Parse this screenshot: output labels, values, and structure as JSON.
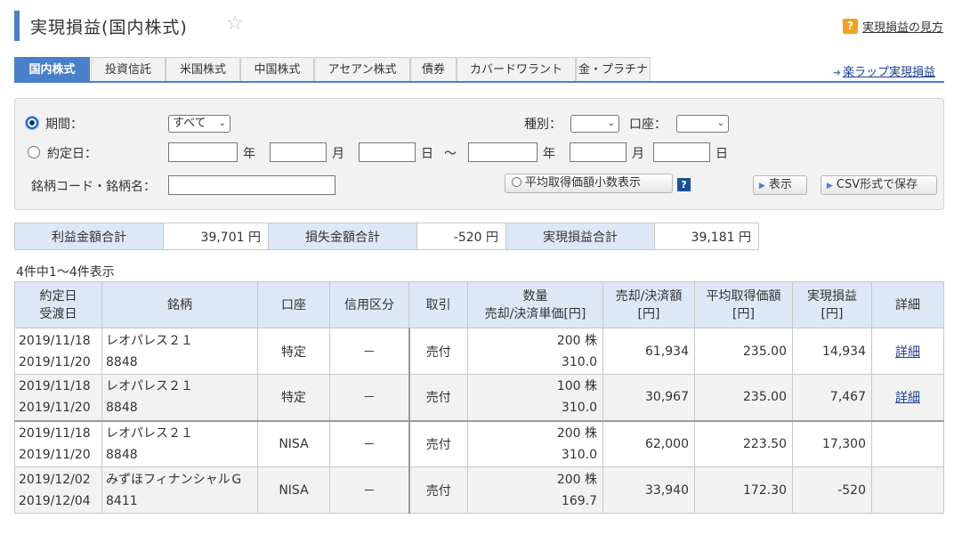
{
  "page": {
    "title": "実現損益(国内株式)",
    "help_label": "実現損益の見方",
    "wrap_link": "楽ラップ実現損益"
  },
  "tabs": [
    "国内株式",
    "投資信託",
    "米国株式",
    "中国株式",
    "アセアン株式",
    "債券",
    "カバードワラント",
    "金・プラチナ"
  ],
  "search": {
    "period_label": "期間：",
    "period_value": "すべて",
    "type_label": "種別：",
    "type_value": "",
    "account_label": "口座：",
    "account_value": "",
    "date_label": "約定日：",
    "year": "年",
    "month": "月",
    "day": "日",
    "tilde": "～",
    "code_label": "銘柄コード・銘柄名：",
    "avg_btn": "平均取得価額小数表示",
    "show_btn": "表示",
    "csv_btn": "CSV形式で保存"
  },
  "summary": {
    "profit_label": "利益金額合計",
    "profit_value": "39,701",
    "loss_label": "損失金額合計",
    "loss_value": "-520",
    "net_label": "実現損益合計",
    "net_value": "39,181",
    "yen": "円"
  },
  "count_text": "4件中1～4件表示",
  "table": {
    "headers": {
      "date1": "約定日",
      "date2": "受渡日",
      "stock": "銘柄",
      "account": "口座",
      "margin": "信用区分",
      "trade": "取引",
      "qty1": "数量",
      "qty2": "売却/決済単価[円]",
      "amount1": "売却/決済額",
      "amount2": "[円]",
      "avg1": "平均取得価額",
      "avg2": "[円]",
      "pl1": "実現損益",
      "pl2": "[円]",
      "detail": "詳細"
    },
    "rows": [
      {
        "trade_date": "2019/11/18",
        "settle_date": "2019/11/20",
        "name": "レオパレス２１",
        "code": "8848",
        "account": "特定",
        "margin": "－",
        "trade": "売付",
        "qty": "200 株",
        "price": "310.0",
        "amount": "61,934",
        "avg": "235.00",
        "pl": "14,934",
        "detail": "詳細"
      },
      {
        "trade_date": "2019/11/18",
        "settle_date": "2019/11/20",
        "name": "レオパレス２１",
        "code": "8848",
        "account": "特定",
        "margin": "－",
        "trade": "売付",
        "qty": "100 株",
        "price": "310.0",
        "amount": "30,967",
        "avg": "235.00",
        "pl": "7,467",
        "detail": "詳細"
      },
      {
        "trade_date": "2019/11/18",
        "settle_date": "2019/11/20",
        "name": "レオパレス２１",
        "code": "8848",
        "account": "NISA",
        "margin": "－",
        "trade": "売付",
        "qty": "200 株",
        "price": "310.0",
        "amount": "62,000",
        "avg": "223.50",
        "pl": "17,300",
        "detail": ""
      },
      {
        "trade_date": "2019/12/02",
        "settle_date": "2019/12/04",
        "name": "みずほフィナンシャルＧ",
        "code": "8411",
        "account": "NISA",
        "margin": "－",
        "trade": "売付",
        "qty": "200 株",
        "price": "169.7",
        "amount": "33,940",
        "avg": "172.30",
        "pl": "-520",
        "detail": ""
      }
    ]
  }
}
